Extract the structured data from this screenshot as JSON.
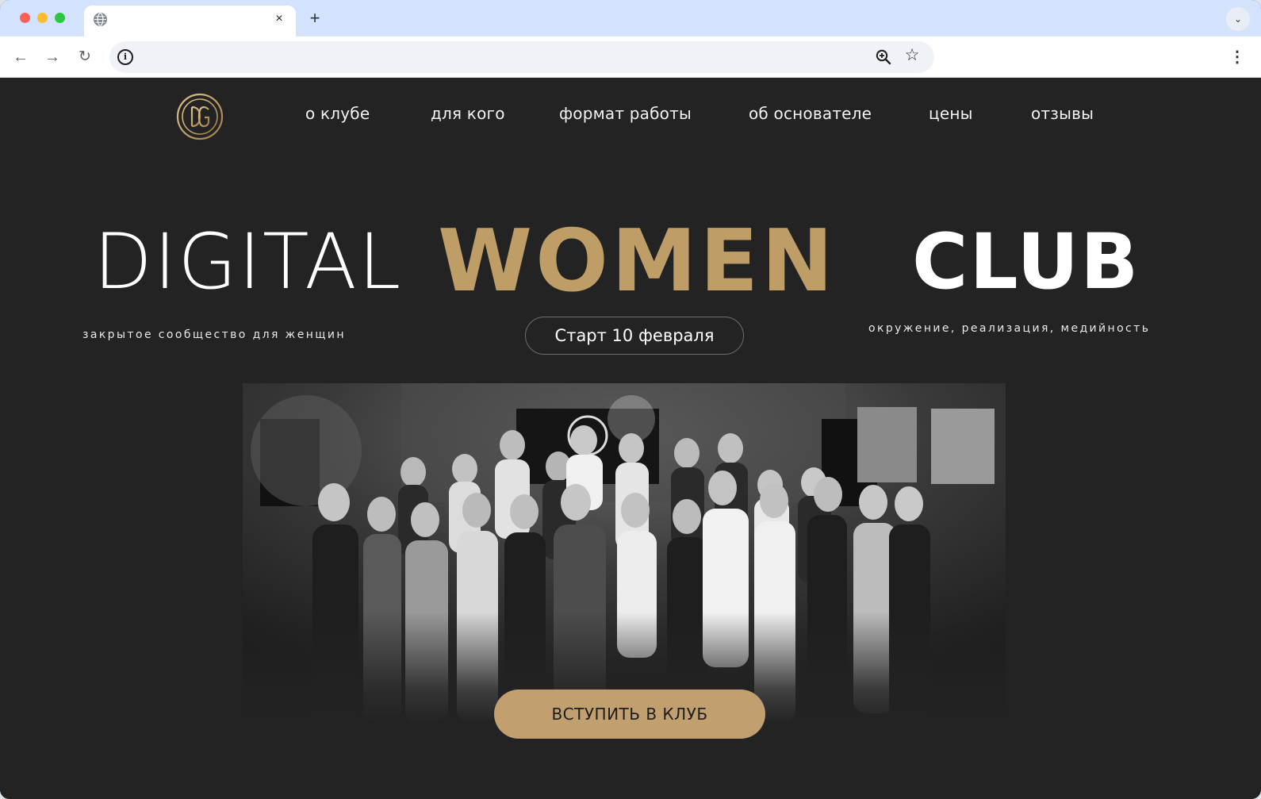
{
  "browser": {
    "tab": {
      "title": "",
      "close_label": "×"
    },
    "new_tab_label": "+",
    "tab_menu_label": "⌄",
    "nav": {
      "back_label": "←",
      "forward_label": "→",
      "reload_label": "↻"
    },
    "omnibox": {
      "value": "",
      "info_label": "i"
    },
    "star_label": "☆",
    "menu_label": "⋮"
  },
  "site": {
    "nav_items": [
      {
        "label": "о клубе"
      },
      {
        "label": "для кого"
      },
      {
        "label": "формат работы"
      },
      {
        "label": "об основателе"
      },
      {
        "label": "цены"
      },
      {
        "label": "отзывы"
      }
    ],
    "hero": {
      "word1": "DIGITAL",
      "word2": "WOMEN",
      "word3": "CLUB",
      "tagline_left": "закрытое сообщество для женщин",
      "tagline_right": "окружение, реализация, медийность",
      "start_label": "Старт 10 февраля",
      "cta_label": "ВСТУПИТЬ В КЛУБ"
    },
    "colors": {
      "accent": "#bf9d67",
      "background": "#232323",
      "cta": "#c19f6e"
    }
  }
}
